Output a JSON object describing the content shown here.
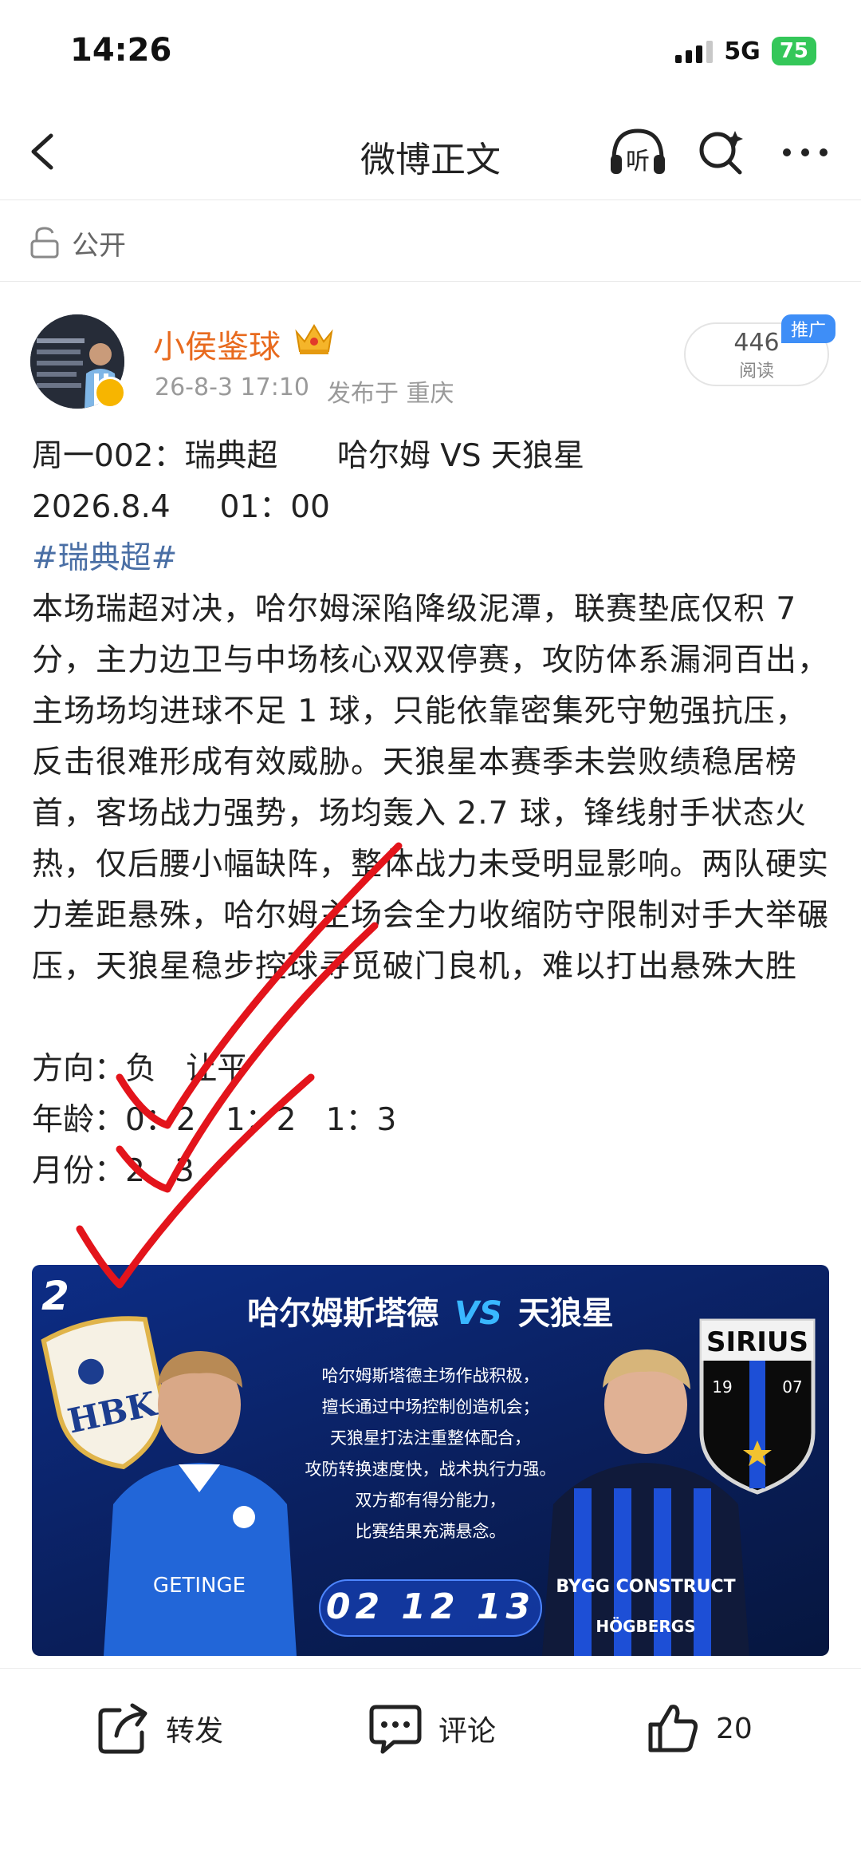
{
  "status": {
    "time": "14:26",
    "network": "5G",
    "battery": "75"
  },
  "nav": {
    "title": "微博正文",
    "listen_label": "听"
  },
  "privacy": {
    "label": "公开"
  },
  "author": {
    "name": "小侯鉴球",
    "date": "26-8-3 17:10",
    "location": "发布于 重庆",
    "reads_count": "446",
    "reads_label": "阅读",
    "promo_label": "推广"
  },
  "post": {
    "line1": "周一002：瑞典超      哈尔姆 VS 天狼星",
    "line2": "2026.8.4     01：00",
    "hashtag": "#瑞典超#",
    "body": "本场瑞超对决，哈尔姆深陷降级泥潭，联赛垫底仅积 7 分，主力边卫与中场核心双双停赛，攻防体系漏洞百出，主场场均进球不足 1 球，只能依靠密集死守勉强抗压，反击很难形成有效威胁。天狼星本赛季未尝败绩稳居榜首，客场战力强势，场均轰入 2.7 球，锋线射手状态火热，仅后腰小幅缺阵，整体战力未受明显影响。两队硬实力差距悬殊，哈尔姆主场会全力收缩防守限制对手大举碾压，天狼星稳步控球寻觅破门良机，难以打出悬殊大胜",
    "direction": "方向：负   让平",
    "age": "年龄：0：2   1：2   1：3",
    "month": "月份：2   3"
  },
  "card": {
    "number": "2",
    "home": "哈尔姆斯塔德",
    "vs": "VS",
    "away": "天狼星",
    "desc": [
      "哈尔姆斯塔德主场作战积极，",
      "擅长通过中场控制创造机会；",
      "天狼星打法注重整体配合，",
      "攻防转换速度快，战术执行力强。",
      "双方都有得分能力，",
      "比赛结果充满悬念。"
    ],
    "scores": "02  12  13",
    "home_crest": "HBK",
    "away_crest": "SIRIUS",
    "away_crest_year_left": "19",
    "away_crest_year_right": "07",
    "home_sponsor": "GETINGE",
    "away_sponsor_1": "BYGG CONSTRUCT",
    "away_sponsor_2": "HÖGBERGS"
  },
  "actions": {
    "share": "转发",
    "comment": "评论",
    "like_count": "20"
  },
  "colors": {
    "author_orange": "#e86a1e",
    "hashtag_blue": "#4a6fa5",
    "promo_blue": "#3e8ef7",
    "check_red": "#e3141b"
  }
}
